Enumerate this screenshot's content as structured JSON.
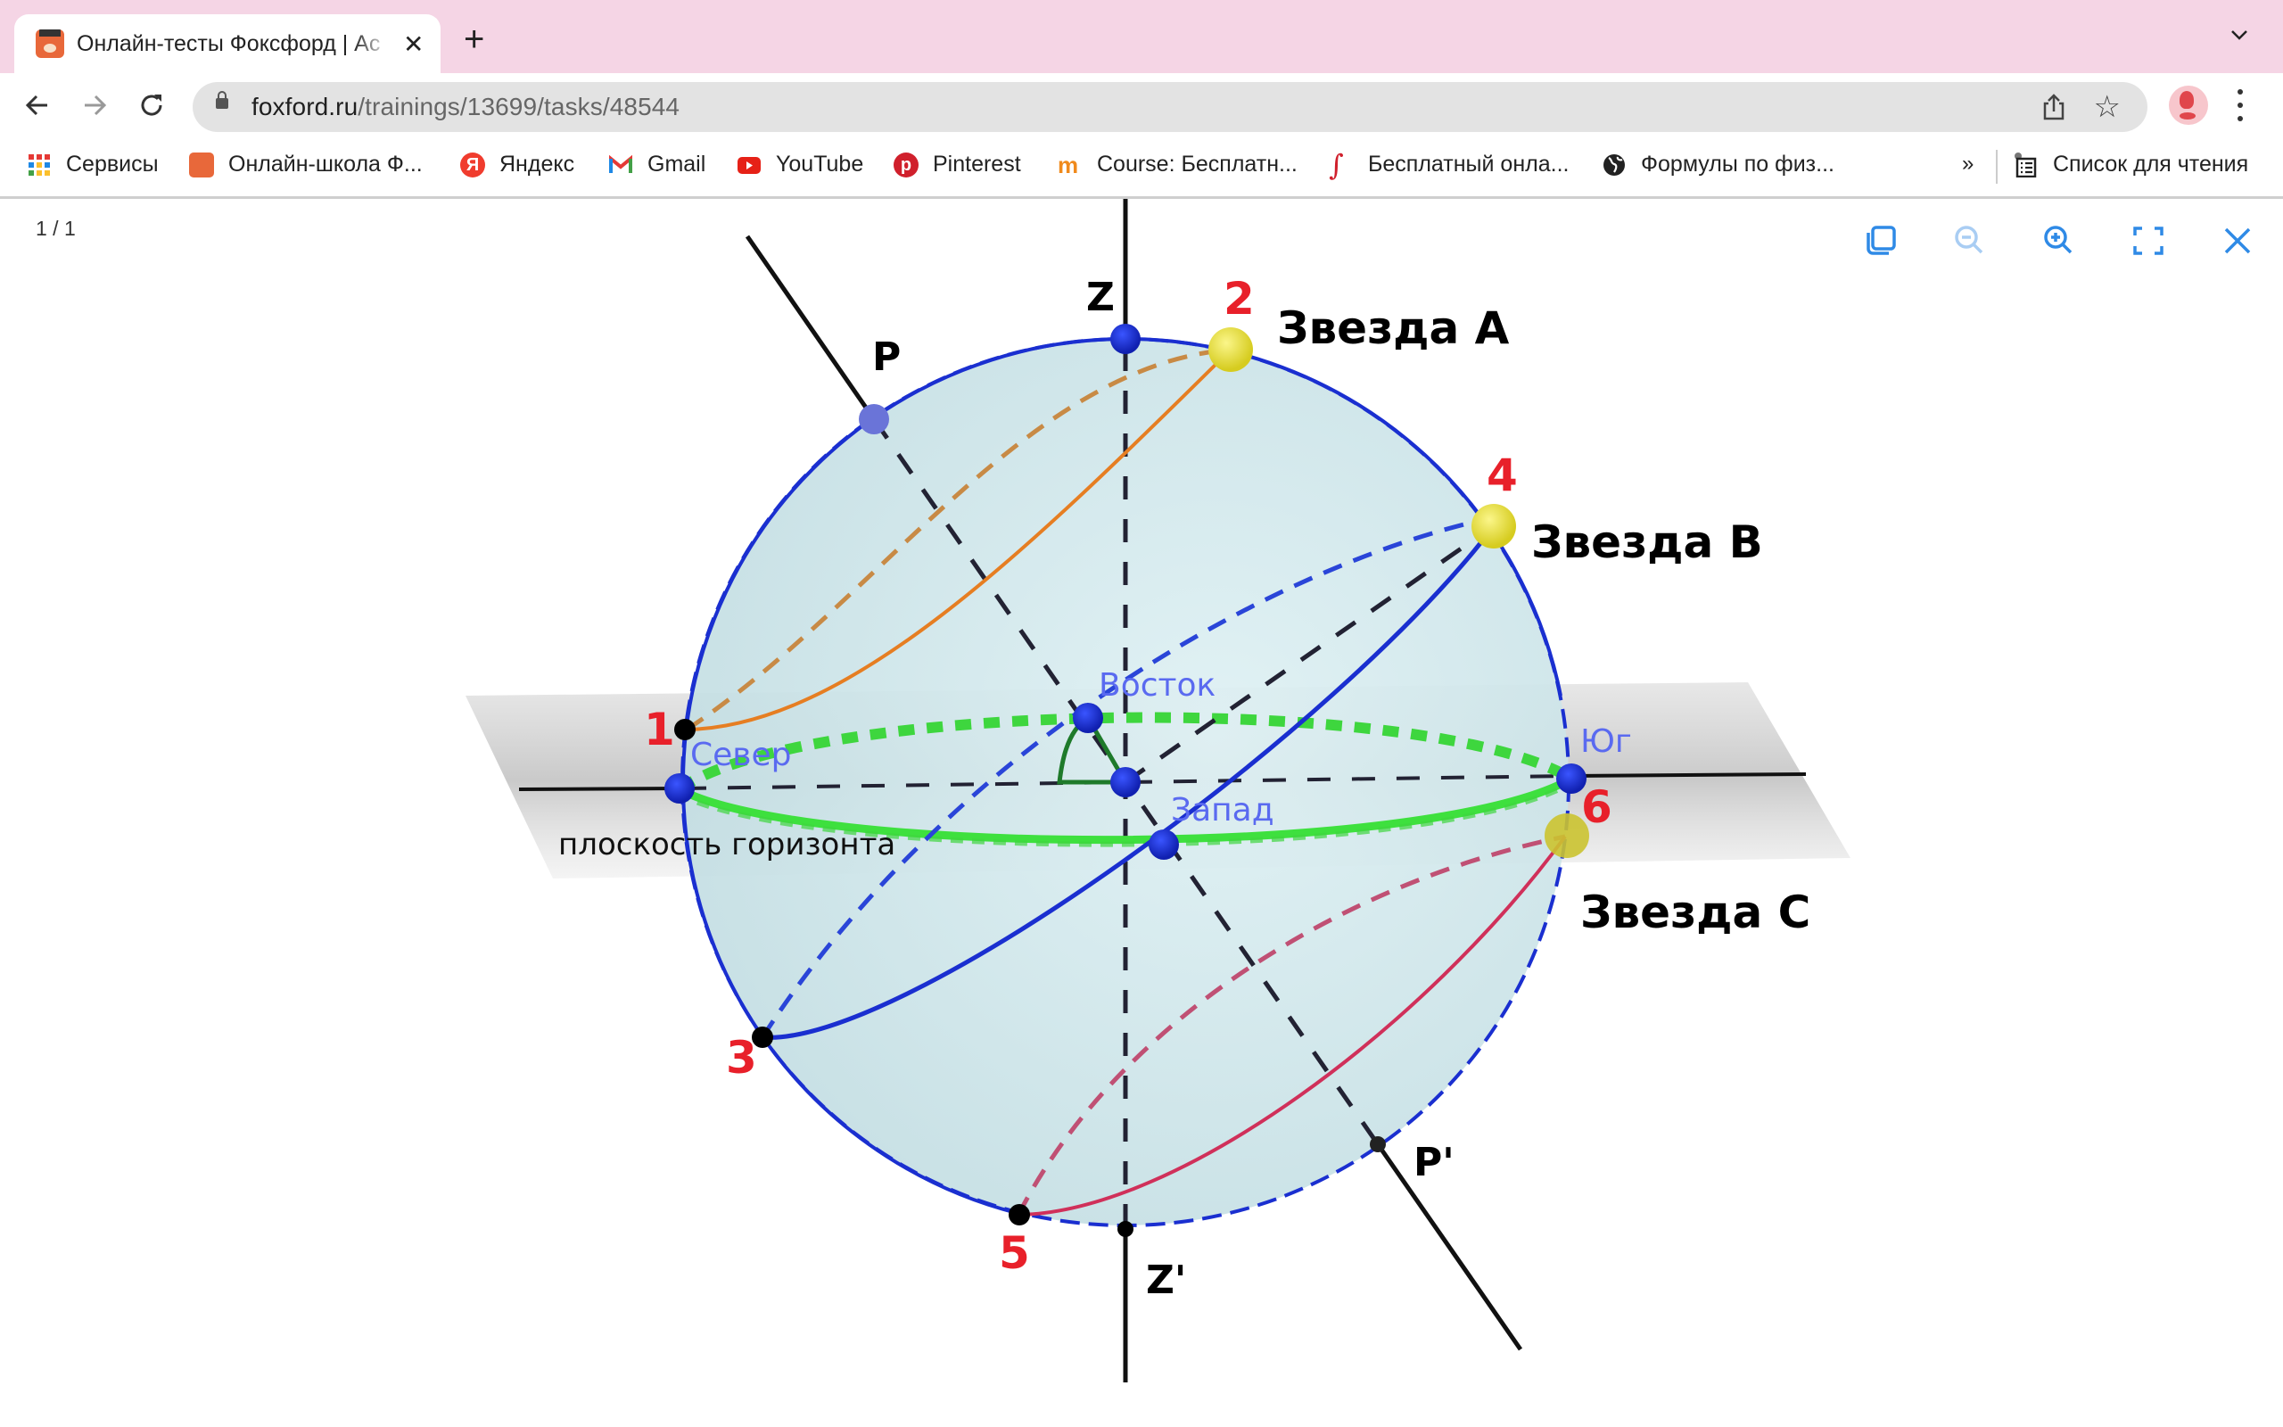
{
  "browser": {
    "tab": {
      "title": "Онлайн-тесты Фоксфорд | Ас",
      "favicon": "foxford-fox-icon",
      "close_icon": "close-icon"
    },
    "new_tab_icon": "plus-icon",
    "tab_search_icon": "chevron-down-icon",
    "nav": {
      "back_icon": "arrow-left-icon",
      "forward_icon": "arrow-right-icon",
      "reload_icon": "reload-icon"
    },
    "address": {
      "host": "foxford.ru",
      "path": "/trainings/13699/tasks/48544",
      "lock_icon": "lock-icon",
      "share_icon": "share-icon",
      "bookmark_icon": "star-icon"
    },
    "profile_icon": "avatar",
    "menu_icon": "kebab-menu-icon",
    "bookmarks": [
      {
        "label": "Сервисы",
        "icon": "apps-grid-icon"
      },
      {
        "label": "Онлайн-школа Ф...",
        "icon": "foxford-fox-icon"
      },
      {
        "label": "Яндекс",
        "icon": "yandex-icon"
      },
      {
        "label": "Gmail",
        "icon": "gmail-icon"
      },
      {
        "label": "YouTube",
        "icon": "youtube-icon"
      },
      {
        "label": "Pinterest",
        "icon": "pinterest-icon"
      },
      {
        "label": "Course: Бесплатн...",
        "icon": "moodle-icon"
      },
      {
        "label": "Бесплатный онла...",
        "icon": "integral-icon"
      },
      {
        "label": "Формулы по физ...",
        "icon": "globe-icon"
      }
    ],
    "bookmarks_overflow": "»",
    "reading_list": {
      "label": "Список для чтения",
      "icon": "reading-list-icon"
    }
  },
  "viewer": {
    "counter": "1 / 1",
    "tools": [
      {
        "name": "copy-icon",
        "enabled": true
      },
      {
        "name": "zoom-out-icon",
        "enabled": false
      },
      {
        "name": "zoom-in-icon",
        "enabled": true
      },
      {
        "name": "fullscreen-icon",
        "enabled": true
      },
      {
        "name": "close-icon",
        "enabled": true
      }
    ],
    "accent": "#2f8ae6"
  },
  "diagram": {
    "axis_labels": {
      "zenith": "Z",
      "nadir": "Z'",
      "pole": "P",
      "pole_south": "P'"
    },
    "directions": {
      "north": "Север",
      "south": "Юг",
      "east": "Восток",
      "west": "Запад"
    },
    "horizon_label": "плоскость горизонта",
    "stars": [
      {
        "label": "Звезда А",
        "color": "#e67e22"
      },
      {
        "label": "Звезда В",
        "color": "#1a2fd0"
      },
      {
        "label": "Звезда С",
        "color": "#d0305a"
      }
    ],
    "point_numbers": [
      "1",
      "2",
      "3",
      "4",
      "5",
      "6"
    ],
    "colors": {
      "sphere_edge": "#1a2fd0",
      "horizon": "#3ee03e",
      "numbers": "#e8202a",
      "star_ball": "#e8e030"
    }
  }
}
